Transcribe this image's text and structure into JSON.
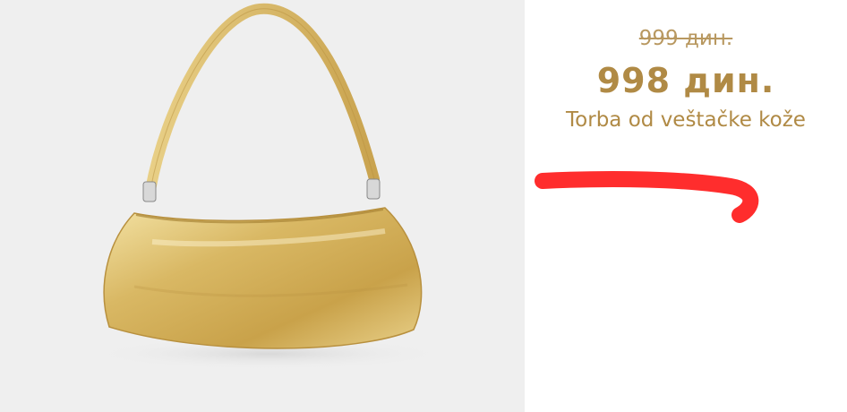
{
  "product": {
    "old_price": "999 дин.",
    "new_price": "998 дин.",
    "title": "Torba od veštačke kože",
    "image_icon": "gold-shoulder-bag"
  },
  "colors": {
    "price": "#b08a45",
    "annotation": "#ff2d2d",
    "photo_background": "#efefef"
  }
}
